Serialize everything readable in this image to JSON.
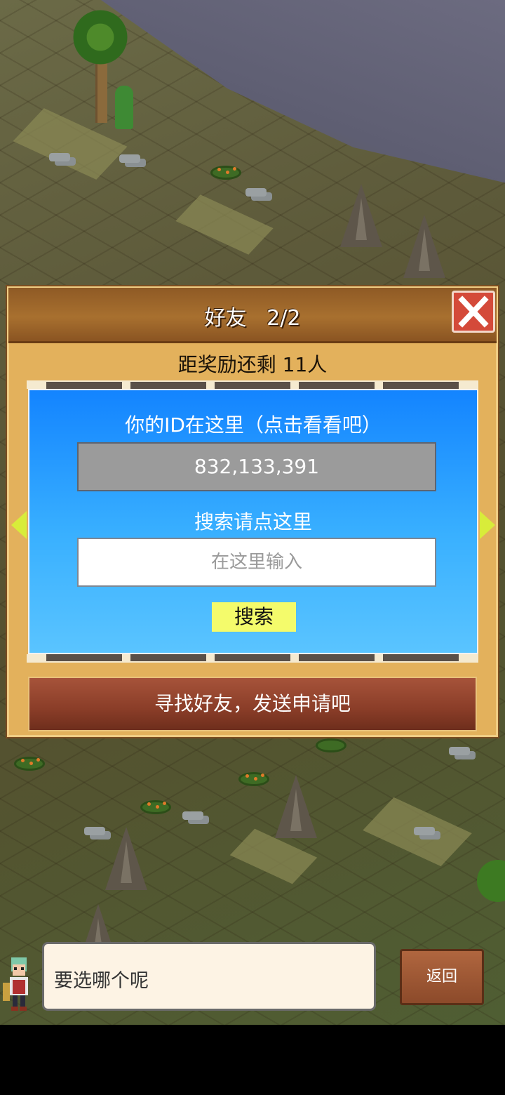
{
  "dialog": {
    "title": "好友",
    "page": "2/2",
    "reward_text": "距奖励还剩 11人",
    "id_label": "你的ID在这里（点击看看吧）",
    "id_value": "832,133,391",
    "search_label": "搜索请点这里",
    "search_placeholder": "在这里输入",
    "search_button": "搜索",
    "send_request": "寻找好友，发送申请吧"
  },
  "message": {
    "text": "要选哪个呢"
  },
  "back_button": "返回",
  "colors": {
    "panel_blue": "#1384ff",
    "frame_gold": "#e3b15c",
    "title_brown": "#a8702f",
    "close_red": "#d44a3a",
    "search_yellow": "#f4fb6b",
    "arrow_yellow": "#d8ec3a"
  },
  "icons": {
    "close": "close-icon",
    "prev": "arrow-left-icon",
    "next": "arrow-right-icon"
  }
}
